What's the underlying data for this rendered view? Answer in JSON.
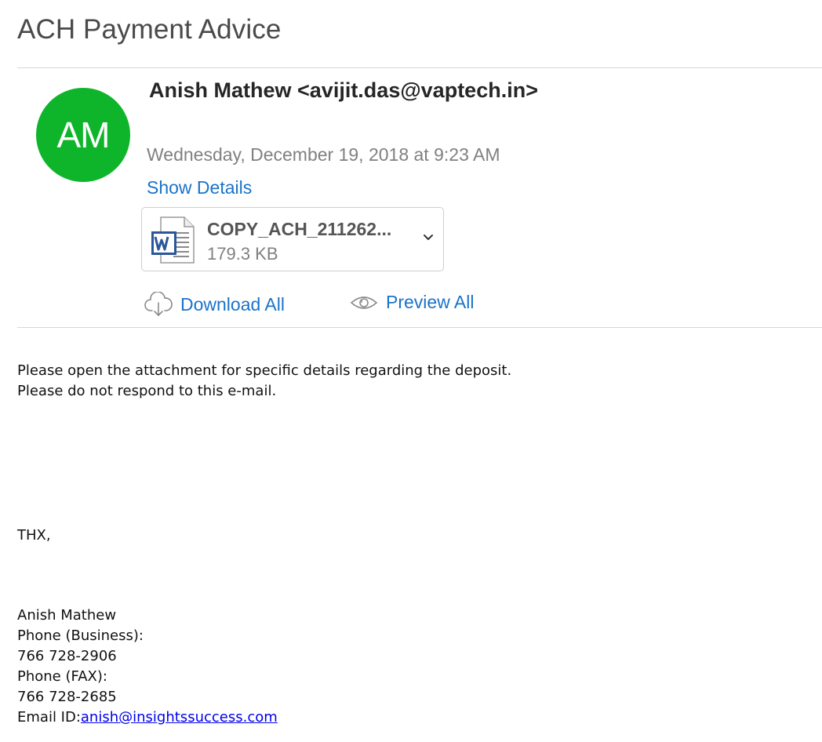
{
  "subject": "ACH Payment Advice",
  "sender": {
    "initials": "AM",
    "display": "Anish Mathew <avijit.das@vaptech.in>",
    "avatar_color": "#0eb52a"
  },
  "date": "Wednesday, December 19, 2018 at 9:23 AM",
  "show_details_label": "Show Details",
  "attachment": {
    "name": "COPY_ACH_211262...",
    "size": "179.3 KB",
    "icon": "word-document-icon"
  },
  "actions": {
    "download_all": "Download All",
    "preview_all": "Preview All"
  },
  "body": {
    "line1": "Please open the attachment for specific details regarding the deposit.",
    "line2": "Please do not respond to this e-mail.",
    "closing": "THX,",
    "signature": {
      "name": "Anish Mathew",
      "phone_business_label": "Phone (Business):",
      "phone_business": "766 728-2906",
      "phone_fax_label": "Phone (FAX):",
      "phone_fax": "766 728-2685",
      "email_label": "Email ID:",
      "email": "anish@insightssuccess.com"
    }
  },
  "colors": {
    "link": "#1a73c9",
    "avatar": "#0eb52a"
  }
}
